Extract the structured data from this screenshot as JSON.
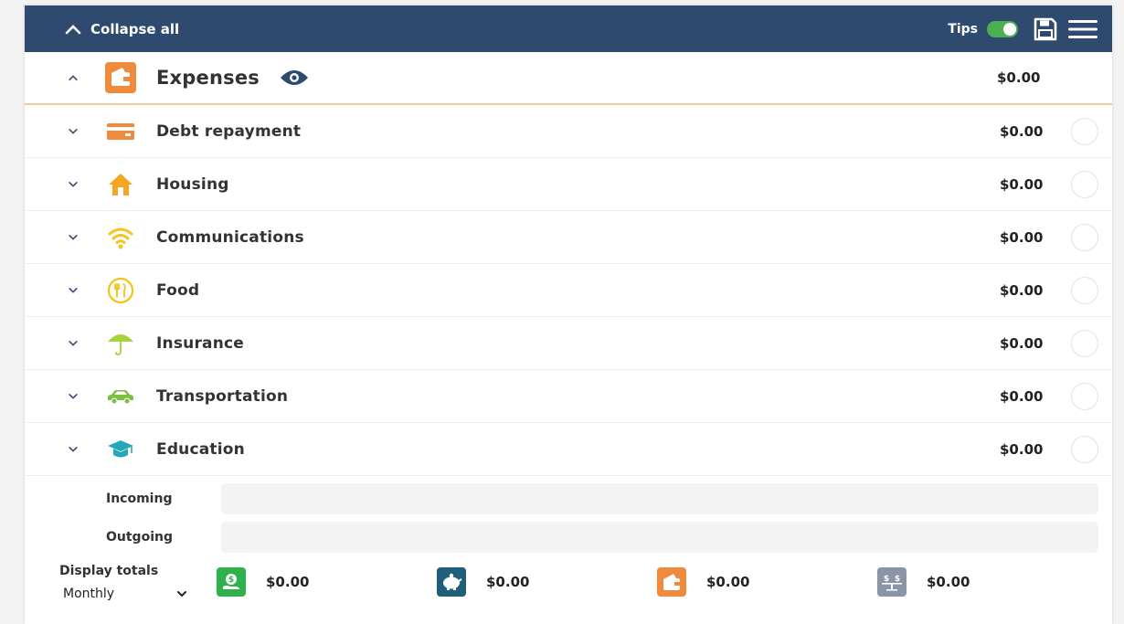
{
  "topbar": {
    "collapse_label": "Collapse all",
    "tips_label": "Tips",
    "tips_on": true,
    "colors": {
      "bar": "#2e4a6e",
      "toggle": "#4caf50"
    }
  },
  "section": {
    "title": "Expenses",
    "amount": "$0.00",
    "icon": "wallet-icon",
    "icon_color": "#f08a3c"
  },
  "categories": [
    {
      "label": "Debt repayment",
      "amount": "$0.00",
      "icon": "card-icon",
      "color": "#f08a3c"
    },
    {
      "label": "Housing",
      "amount": "$0.00",
      "icon": "house-icon",
      "color": "#f5a623"
    },
    {
      "label": "Communications",
      "amount": "$0.00",
      "icon": "wifi-icon",
      "color": "#f7c21c"
    },
    {
      "label": "Food",
      "amount": "$0.00",
      "icon": "utensils-icon",
      "color": "#f0c419"
    },
    {
      "label": "Insurance",
      "amount": "$0.00",
      "icon": "umbrella-icon",
      "color": "#a7d33a"
    },
    {
      "label": "Transportation",
      "amount": "$0.00",
      "icon": "car-icon",
      "color": "#7cc043"
    },
    {
      "label": "Education",
      "amount": "$0.00",
      "icon": "graduation-cap-icon",
      "color": "#23a8b8"
    }
  ],
  "flows": {
    "incoming_label": "Incoming",
    "outgoing_label": "Outgoing"
  },
  "totals": {
    "display_label": "Display totals",
    "period": "Monthly",
    "items": [
      {
        "icon": "income-icon",
        "value": "$0.00",
        "color": "#2fb24c"
      },
      {
        "icon": "savings-icon",
        "value": "$0.00",
        "color": "#1f5f7a"
      },
      {
        "icon": "expenses-wallet-icon",
        "value": "$0.00",
        "color": "#f08a3c"
      },
      {
        "icon": "balance-scale-icon",
        "value": "$0.00",
        "color": "#8a96a8"
      }
    ]
  }
}
